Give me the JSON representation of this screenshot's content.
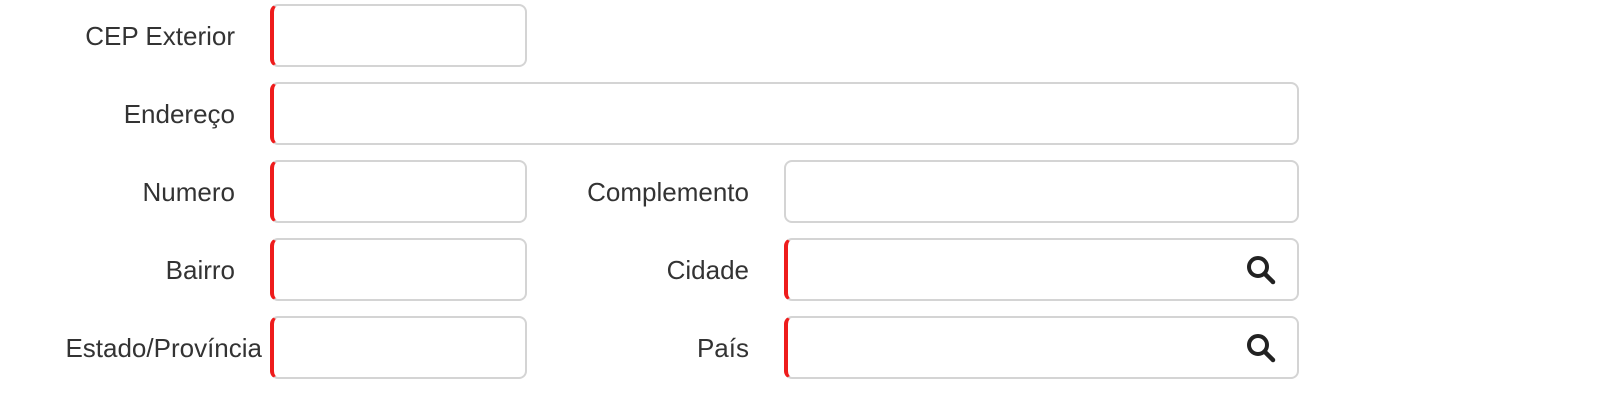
{
  "form": {
    "cep_exterior": {
      "label": "CEP Exterior",
      "value": "",
      "required": true
    },
    "endereco": {
      "label": "Endereço",
      "value": "",
      "required": true
    },
    "numero": {
      "label": "Numero",
      "value": "",
      "required": true
    },
    "complemento": {
      "label": "Complemento",
      "value": "",
      "required": false
    },
    "bairro": {
      "label": "Bairro",
      "value": "",
      "required": true
    },
    "cidade": {
      "label": "Cidade",
      "value": "",
      "required": true,
      "icon": "search-icon"
    },
    "estado_provincia": {
      "label": "Estado/Província",
      "value": "",
      "required": true
    },
    "pais": {
      "label": "País",
      "value": "",
      "required": true,
      "icon": "search-icon"
    }
  },
  "colors": {
    "required_accent": "#ee1c1c",
    "border": "#d4d4d4",
    "label_text": "#333333"
  }
}
